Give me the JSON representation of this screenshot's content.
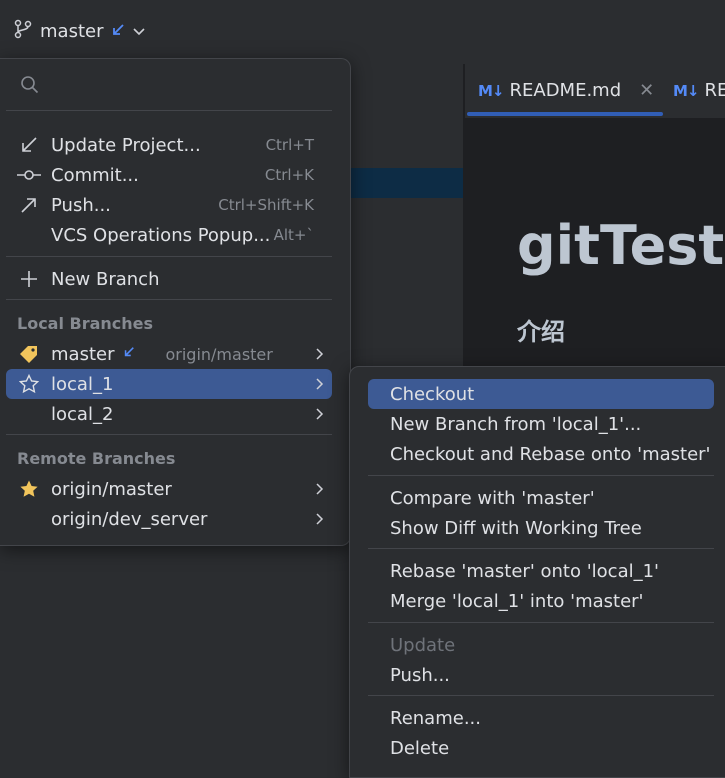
{
  "toolbar": {
    "branch_name": "master"
  },
  "tabs": [
    {
      "label": "README.md"
    },
    {
      "label": "RE"
    }
  ],
  "preview": {
    "heading1": "gitTest",
    "heading2": "介绍"
  },
  "popup": {
    "search_placeholder": "",
    "actions": [
      {
        "label": "Update Project...",
        "shortcut": "Ctrl+T"
      },
      {
        "label": "Commit...",
        "shortcut": "Ctrl+K"
      },
      {
        "label": "Push...",
        "shortcut": "Ctrl+Shift+K"
      },
      {
        "label": "VCS Operations Popup...",
        "shortcut": "Alt+`"
      }
    ],
    "new_branch": "New Branch",
    "local_header": "Local Branches",
    "local": [
      {
        "label": "master",
        "tracking": "origin/master"
      },
      {
        "label": "local_1"
      },
      {
        "label": "local_2"
      }
    ],
    "remote_header": "Remote Branches",
    "remote": [
      {
        "label": "origin/master"
      },
      {
        "label": "origin/dev_server"
      }
    ]
  },
  "submenu": {
    "items": [
      "Checkout",
      "New Branch from 'local_1'...",
      "Checkout and Rebase onto 'master'",
      "Compare with 'master'",
      "Show Diff with Working Tree",
      "Rebase 'master' onto 'local_1'",
      "Merge 'local_1' into 'master'",
      "Update",
      "Push...",
      "Rename...",
      "Delete"
    ]
  },
  "colors": {
    "accent": "#3d5a94",
    "incoming": "#548af7",
    "star": "#f2c55c"
  }
}
